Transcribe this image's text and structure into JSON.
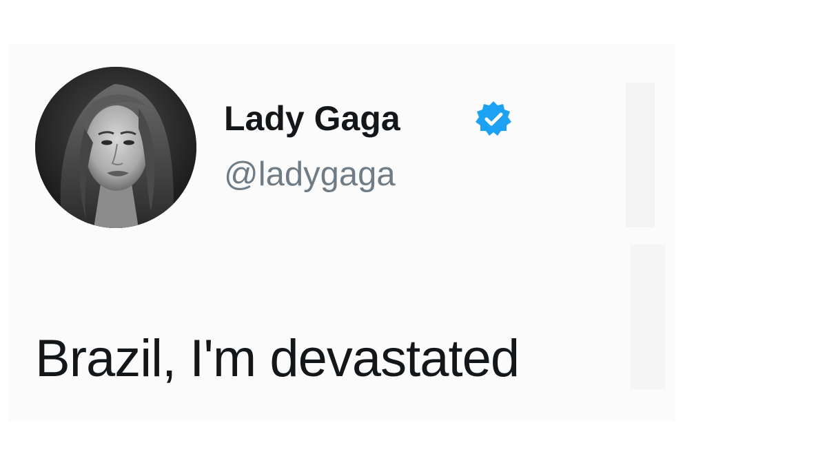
{
  "tweet": {
    "display_name": "Lady Gaga",
    "handle": "@ladygaga",
    "text": "Brazil, I'm devastated",
    "verified": true
  },
  "icons": {
    "verified": "verified-badge-icon",
    "avatar": "profile-photo"
  },
  "colors": {
    "verified_blue": "#1da1f2",
    "name_text": "#14171a",
    "handle_text": "#6f7c86",
    "card_background": "#fbfbfb"
  }
}
